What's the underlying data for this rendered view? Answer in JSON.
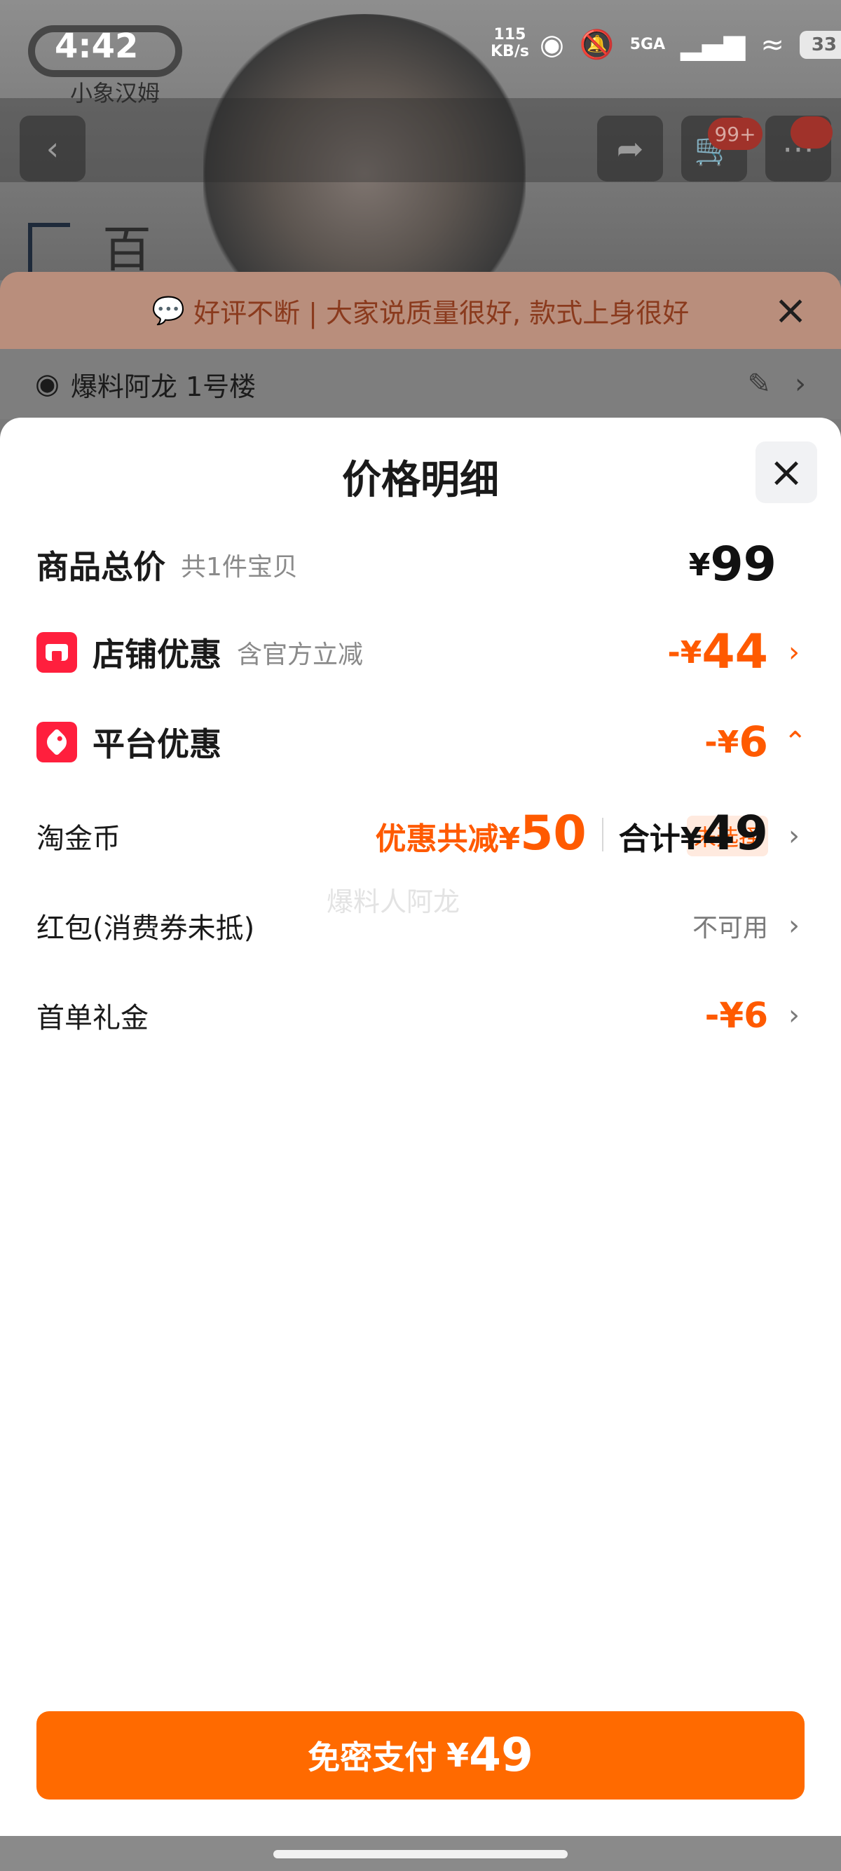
{
  "status_bar": {
    "time": "4:42",
    "speed_value": "115",
    "speed_unit": "KB/s",
    "network": "5GA",
    "battery": "33",
    "app_logo_sub": "小象汉姆"
  },
  "background": {
    "cart_badge": "99+",
    "title_fragment": "百",
    "review_banner": "好评不断 | 大家说质量很好, 款式上身很好",
    "address": "爆料阿龙 1号楼"
  },
  "sheet": {
    "title": "价格明细",
    "watermark": "爆料人阿龙",
    "rows": {
      "total": {
        "label": "商品总价",
        "sub": "共1件宝贝",
        "currency": "¥",
        "value": "99"
      },
      "shop_discount": {
        "label": "店铺优惠",
        "sub": "含官方立减",
        "prefix": "-¥",
        "value": "44"
      },
      "platform_discount": {
        "label": "平台优惠",
        "prefix": "-¥",
        "value": "6"
      },
      "taojinbi": {
        "label": "淘金币",
        "value": "未选择"
      },
      "hongbao": {
        "label": "红包(消费券未抵)",
        "value": "不可用"
      },
      "first_order": {
        "label": "首单礼金",
        "value": "-¥6"
      }
    },
    "summary": {
      "discount_label": "优惠共减",
      "discount_currency": "¥",
      "discount_value": "50",
      "total_label": "合计",
      "total_currency": "¥",
      "total_value": "49"
    },
    "pay_button": {
      "label": "免密支付",
      "currency": "¥",
      "value": "49"
    }
  },
  "colors": {
    "accent_orange": "#ff5a00",
    "pay_button": "#ff6a00",
    "icon_red": "#ff1f3d"
  }
}
